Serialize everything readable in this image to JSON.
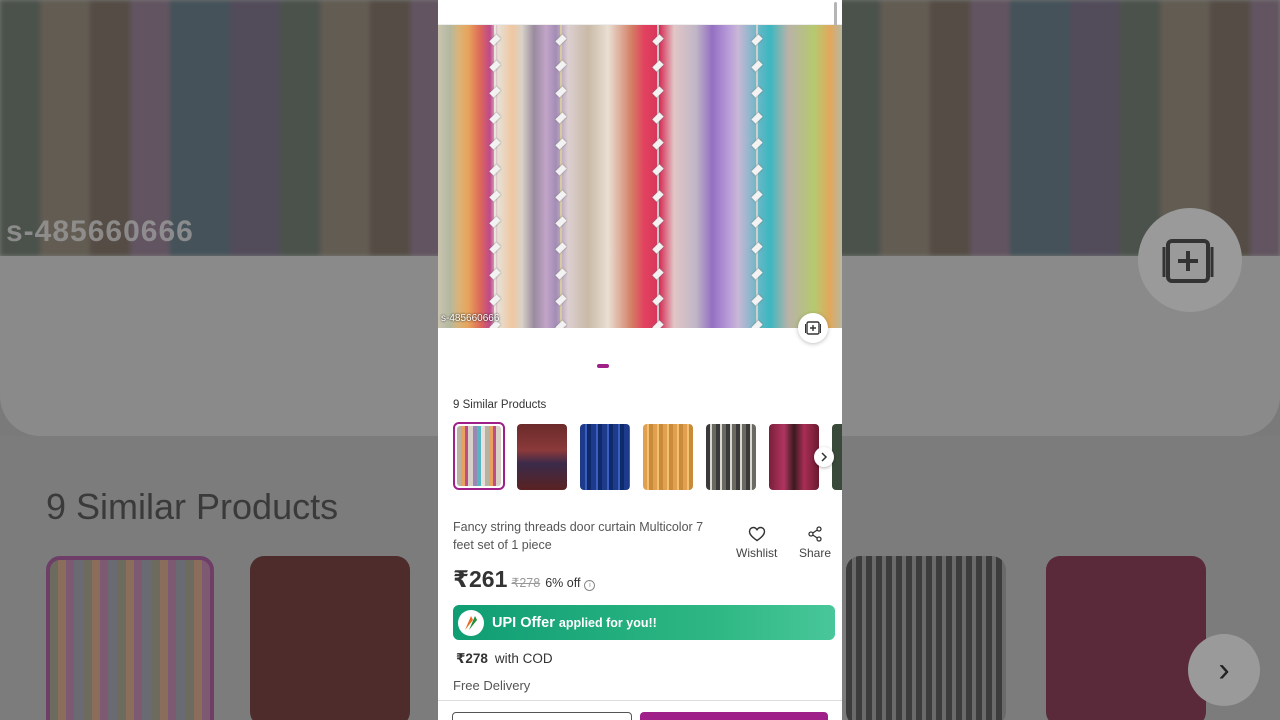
{
  "backdrop": {
    "watermark": "s-485660666",
    "similar_title": "9 Similar Products"
  },
  "product": {
    "image_watermark": "s-485660666",
    "view_similar_icon": "add-to-collection-icon",
    "carousel_position": 1,
    "similar_title": "9 Similar Products",
    "similar_count": 9,
    "name": "Fancy string threads door curtain Multicolor 7 feet set of 1 piece",
    "wishlist_label": "Wishlist",
    "share_label": "Share",
    "price": "₹261",
    "mrp": "₹278",
    "discount": "6% off",
    "upi_offer_main": "UPI Offer",
    "upi_offer_sub": "applied for you!!",
    "cod_price": "₹278",
    "cod_label": "with COD",
    "delivery": "Free Delivery"
  },
  "colors": {
    "accent": "#9f2089",
    "upi_green": "#1aa67a"
  },
  "icons": {
    "wishlist": "heart-outline-icon",
    "share": "share-icon",
    "next": "chevron-right-icon",
    "info": "info-icon"
  }
}
